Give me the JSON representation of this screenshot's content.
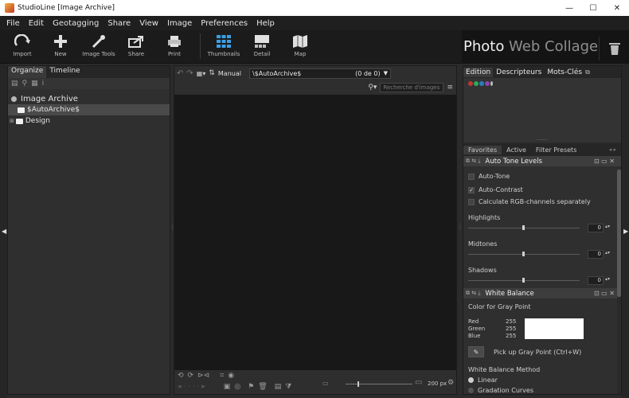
{
  "window": {
    "title": "StudioLine [Image Archive]",
    "minimize": "—",
    "maximize": "☐",
    "close": "✕"
  },
  "menu": [
    "File",
    "Edit",
    "Geotagging",
    "Share",
    "View",
    "Image",
    "Preferences",
    "Help"
  ],
  "toolbar": {
    "import": "Import",
    "new": "New",
    "image_tools": "Image Tools",
    "share": "Share",
    "print": "Print",
    "thumbnails": "Thumbnails",
    "detail": "Detail",
    "map": "Map"
  },
  "modes": {
    "photo": "Photo",
    "web": "Web",
    "collage": "Collage"
  },
  "left": {
    "tabs": [
      "Organize",
      "Timeline"
    ],
    "tree": {
      "root": "Image Archive",
      "folder1": "$AutoArchive$",
      "folder2": "Design"
    }
  },
  "center": {
    "sort_label": "Manual",
    "path": "\\$AutoArchive$",
    "count": "(0 de 0)",
    "search_placeholder": "Recherche d'images",
    "thumb_size": "200 px"
  },
  "right": {
    "tabs": [
      "Edition",
      "Descripteurs",
      "Mots-Clés"
    ],
    "subtabs": [
      "Favorites",
      "Active",
      "Filter Presets"
    ],
    "auto_tone": {
      "title": "Auto Tone Levels",
      "auto_tone": "Auto-Tone",
      "auto_contrast": "Auto-Contrast",
      "rgb_sep": "Calculate RGB-channels separately",
      "highlights": "Highlights",
      "highlights_val": "0",
      "midtones": "Midtones",
      "midtones_val": "0",
      "shadows": "Shadows",
      "shadows_val": "0"
    },
    "white_balance": {
      "title": "White Balance",
      "color_gray": "Color for Gray Point",
      "red": "Red",
      "green": "Green",
      "blue": "Blue",
      "red_val": "255",
      "green_val": "255",
      "blue_val": "255",
      "pick": "Pick up Gray Point (Ctrl+W)",
      "method": "White Balance Method",
      "linear": "Linear",
      "gradation": "Gradation Curves"
    }
  },
  "colors": {
    "bg": "#2b2b2b",
    "viewer": "#181818",
    "swatch": "#ffffff"
  }
}
